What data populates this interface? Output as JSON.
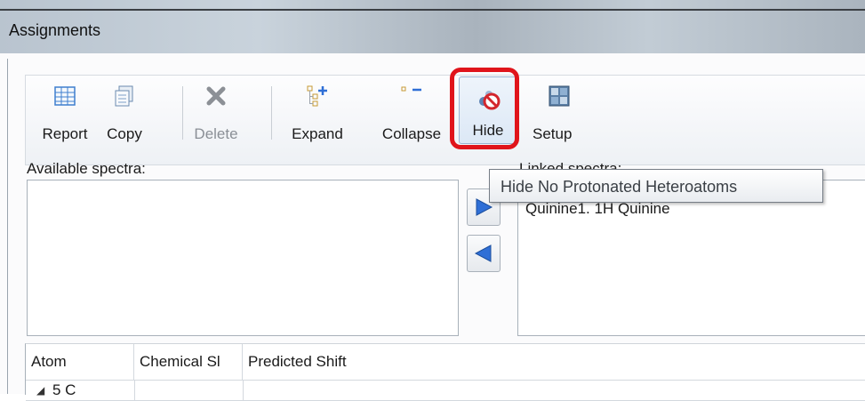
{
  "window": {
    "title": "Assignments"
  },
  "toolbar": {
    "buttons": [
      {
        "label": "Report",
        "icon": "table-grid-icon",
        "enabled": true
      },
      {
        "label": "Copy",
        "icon": "copy-icon",
        "enabled": true
      },
      {
        "label": "Delete",
        "icon": "delete-x-icon",
        "enabled": false
      },
      {
        "label": "Expand",
        "icon": "expand-tree-icon",
        "enabled": true
      },
      {
        "label": "Collapse",
        "icon": "collapse-tree-icon",
        "enabled": true
      },
      {
        "label": "Hide",
        "icon": "hide-atoms-icon",
        "enabled": true,
        "highlighted": true
      },
      {
        "label": "Setup",
        "icon": "setup-icon",
        "enabled": true
      }
    ]
  },
  "spectra": {
    "available_label": "Available spectra:",
    "linked_label": "Linked spectra:",
    "linked_items": [
      "Quinine1. 1H Quinine"
    ]
  },
  "tooltip": {
    "text": "Hide No Protonated Heteroatoms"
  },
  "table": {
    "columns": [
      "Atom",
      "Chemical Sl",
      "Predicted Shift"
    ],
    "rows": [
      {
        "atom": "5 C",
        "chemical_shift": "",
        "predicted_shift": "",
        "expanded": true
      }
    ]
  },
  "colors": {
    "highlight": "#e0141b",
    "accent_blue": "#2f6fd6"
  }
}
